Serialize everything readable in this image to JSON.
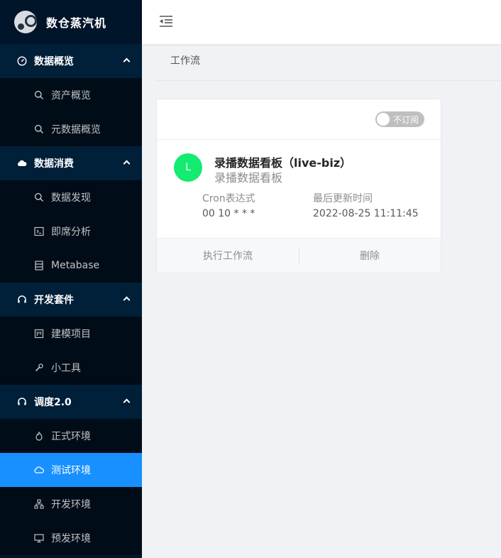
{
  "app": {
    "title": "数仓蒸汽机"
  },
  "sidebar": {
    "groups": [
      {
        "label": "数据概览",
        "icon": "dashboard-icon",
        "items": [
          {
            "label": "资产概览",
            "icon": "search-icon"
          },
          {
            "label": "元数据概览",
            "icon": "search-icon"
          }
        ]
      },
      {
        "label": "数据消费",
        "icon": "cloud-icon",
        "items": [
          {
            "label": "数据发现",
            "icon": "search-icon"
          },
          {
            "label": "即席分析",
            "icon": "terminal-icon"
          },
          {
            "label": "Metabase",
            "icon": "database-icon"
          }
        ]
      },
      {
        "label": "开发套件",
        "icon": "headset-icon",
        "items": [
          {
            "label": "建模项目",
            "icon": "project-icon"
          },
          {
            "label": "小工具",
            "icon": "tool-icon"
          }
        ]
      },
      {
        "label": "调度2.0",
        "icon": "headset-icon",
        "items": [
          {
            "label": "正式环境",
            "icon": "fire-icon"
          },
          {
            "label": "测试环境",
            "icon": "cloud-outline-icon",
            "active": true
          },
          {
            "label": "开发环境",
            "icon": "cluster-icon"
          },
          {
            "label": "预发环境",
            "icon": "monitor-icon"
          }
        ]
      }
    ]
  },
  "page": {
    "title": "工作流"
  },
  "card": {
    "switch_label": "不订阅",
    "switch_on": false,
    "avatar_letter": "L",
    "avatar_color": "#13eb71",
    "name": "录播数据看板（live-biz）",
    "subtitle": "录播数据看板",
    "cron_label": "Cron表达式",
    "cron_value": "00 10 * * *",
    "updated_label": "最后更新时间",
    "updated_value": "2022-08-25 11:11:45",
    "actions": {
      "run": "执行工作流",
      "delete": "删除"
    }
  },
  "colors": {
    "sidebar_bg": "#001529",
    "active": "#1890ff",
    "avatar": "#13eb71"
  }
}
